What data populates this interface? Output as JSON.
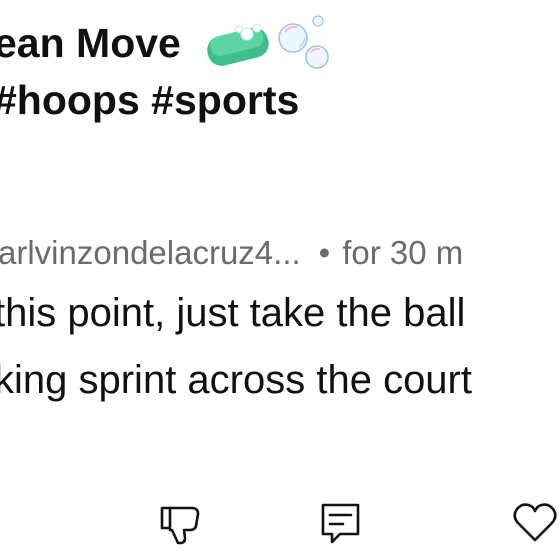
{
  "post": {
    "title_line_1": "ean Move",
    "title_emoji": "soap-bubbles-emoji",
    "title_line_2": " #hoops #sports"
  },
  "comment": {
    "author": "arlvinzondelacruz4...",
    "separator": "•",
    "timestamp": "for 30 m",
    "text_line_1": "this point, just take the ball",
    "text_line_2": "king sprint across the court"
  },
  "actions": {
    "dislike_icon": "thumbs-down-icon",
    "reply_icon": "comment-icon",
    "like_icon": "heart-icon"
  }
}
